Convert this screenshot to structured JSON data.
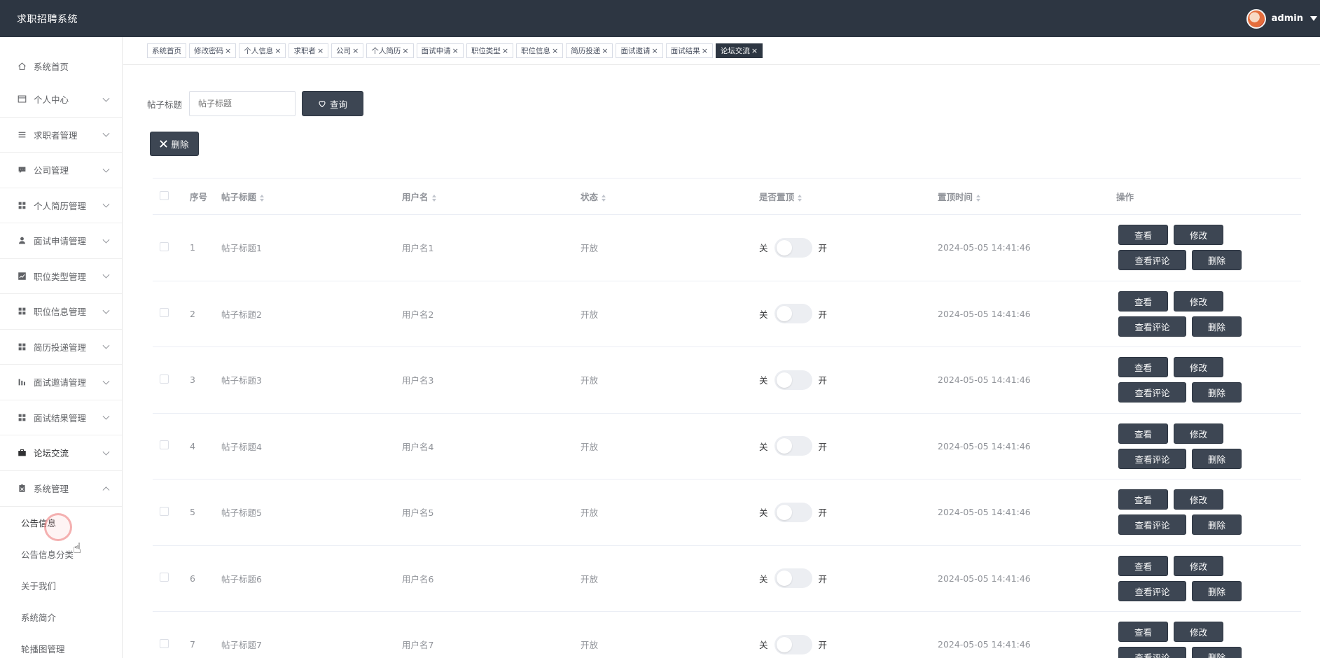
{
  "app": {
    "title": "求职招聘系统",
    "user": "admin"
  },
  "sidebar": {
    "items": [
      {
        "label": "系统首页",
        "icon": "home-icon",
        "name": "sidebar-item-home",
        "arrow": "none"
      },
      {
        "label": "个人中心",
        "icon": "profile-card-icon",
        "name": "sidebar-item-personal-center",
        "arrow": "down"
      },
      {
        "label": "求职者管理",
        "icon": "list-icon",
        "name": "sidebar-item-jobseekers",
        "arrow": "down"
      },
      {
        "label": "公司管理",
        "icon": "chat-icon",
        "name": "sidebar-item-companies",
        "arrow": "down"
      },
      {
        "label": "个人简历管理",
        "icon": "grid-icon",
        "name": "sidebar-item-resumes",
        "arrow": "down"
      },
      {
        "label": "面试申请管理",
        "icon": "user-icon",
        "name": "sidebar-item-interview-applications",
        "arrow": "down"
      },
      {
        "label": "职位类型管理",
        "icon": "chart-icon",
        "name": "sidebar-item-position-types",
        "arrow": "down"
      },
      {
        "label": "职位信息管理",
        "icon": "grid-icon",
        "name": "sidebar-item-positions",
        "arrow": "down"
      },
      {
        "label": "简历投递管理",
        "icon": "grid-icon",
        "name": "sidebar-item-deliveries",
        "arrow": "down"
      },
      {
        "label": "面试邀请管理",
        "icon": "bar-chart-icon",
        "name": "sidebar-item-invitations",
        "arrow": "down"
      },
      {
        "label": "面试结果管理",
        "icon": "grid-icon",
        "name": "sidebar-item-results",
        "arrow": "down"
      },
      {
        "label": "论坛交流",
        "icon": "briefcase-icon",
        "name": "sidebar-item-forum",
        "arrow": "down"
      },
      {
        "label": "系统管理",
        "icon": "clipboard-icon",
        "name": "sidebar-item-system",
        "arrow": "up"
      }
    ],
    "submenu": [
      {
        "label": "公告信息",
        "name": "submenu-item-notices"
      },
      {
        "label": "公告信息分类",
        "name": "submenu-item-notice-categories"
      },
      {
        "label": "关于我们",
        "name": "submenu-item-about"
      },
      {
        "label": "系统简介",
        "name": "submenu-item-intro"
      },
      {
        "label": "轮播图管理",
        "name": "submenu-item-carousel"
      }
    ]
  },
  "tags": [
    {
      "label": "系统首页",
      "closable": false,
      "active": false
    },
    {
      "label": "修改密码",
      "closable": true,
      "active": false
    },
    {
      "label": "个人信息",
      "closable": true,
      "active": false
    },
    {
      "label": "求职者",
      "closable": true,
      "active": false
    },
    {
      "label": "公司",
      "closable": true,
      "active": false
    },
    {
      "label": "个人简历",
      "closable": true,
      "active": false
    },
    {
      "label": "面试申请",
      "closable": true,
      "active": false
    },
    {
      "label": "职位类型",
      "closable": true,
      "active": false
    },
    {
      "label": "职位信息",
      "closable": true,
      "active": false
    },
    {
      "label": "简历投递",
      "closable": true,
      "active": false
    },
    {
      "label": "面试邀请",
      "closable": true,
      "active": false
    },
    {
      "label": "面试结果",
      "closable": true,
      "active": false
    },
    {
      "label": "论坛交流",
      "closable": true,
      "active": true
    }
  ],
  "search": {
    "label": "帖子标题",
    "placeholder": "帖子标题",
    "query_label": "查询"
  },
  "toolbar": {
    "delete_label": "删除"
  },
  "table": {
    "headers": {
      "index": "序号",
      "title": "帖子标题",
      "user": "用户名",
      "status": "状态",
      "pinned": "是否置顶",
      "pin_time": "置顶时间",
      "ops": "操作"
    },
    "switch": {
      "off": "关",
      "on": "开"
    },
    "actions": {
      "view": "查看",
      "edit": "修改",
      "comments": "查看评论",
      "delete": "删除"
    },
    "rows": [
      {
        "index": "1",
        "title": "帖子标题1",
        "user": "用户名1",
        "status": "开放",
        "time": "2024-05-05 14:41:46"
      },
      {
        "index": "2",
        "title": "帖子标题2",
        "user": "用户名2",
        "status": "开放",
        "time": "2024-05-05 14:41:46"
      },
      {
        "index": "3",
        "title": "帖子标题3",
        "user": "用户名3",
        "status": "开放",
        "time": "2024-05-05 14:41:46"
      },
      {
        "index": "4",
        "title": "帖子标题4",
        "user": "用户名4",
        "status": "开放",
        "time": "2024-05-05 14:41:46"
      },
      {
        "index": "5",
        "title": "帖子标题5",
        "user": "用户名5",
        "status": "开放",
        "time": "2024-05-05 14:41:46"
      },
      {
        "index": "6",
        "title": "帖子标题6",
        "user": "用户名6",
        "status": "开放",
        "time": "2024-05-05 14:41:46"
      },
      {
        "index": "7",
        "title": "帖子标题7",
        "user": "用户名7",
        "status": "开放",
        "time": "2024-05-05 14:41:46"
      }
    ]
  }
}
